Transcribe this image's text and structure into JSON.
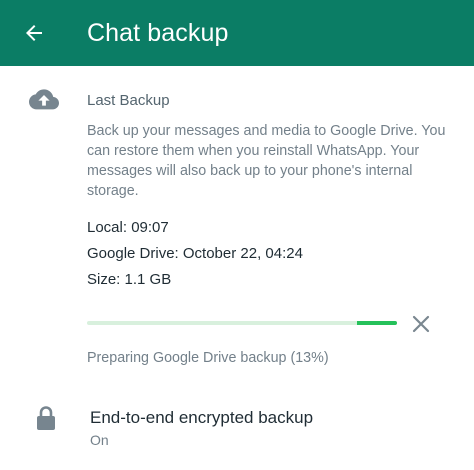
{
  "appbar": {
    "title": "Chat backup",
    "back_icon": "arrow-left-icon",
    "background": "#0b7d65"
  },
  "last_backup": {
    "icon": "cloud-upload-icon",
    "title": "Last Backup",
    "description": "Back up your messages and media to Google Drive. You can restore them when you reinstall WhatsApp. Your messages will also back up to your phone's internal storage.",
    "local": "Local: 09:07",
    "google_drive": "Google Drive: October 22, 04:24",
    "size": "Size: 1.1 GB"
  },
  "progress": {
    "percent": 13,
    "status": "Preparing Google Drive backup (13%)",
    "track_color": "#d8f0dd",
    "fill_color": "#25c15a",
    "cancel_icon": "close-icon"
  },
  "encryption": {
    "icon": "lock-icon",
    "title": "End-to-end encrypted backup",
    "status": "On"
  }
}
